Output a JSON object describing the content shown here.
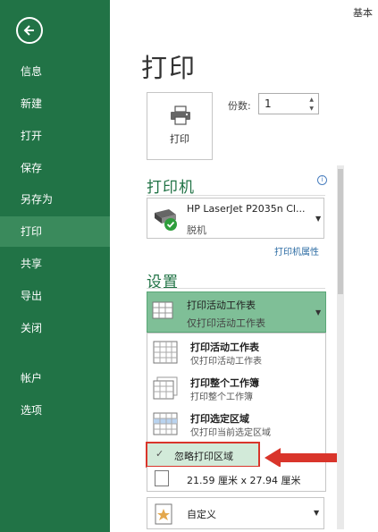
{
  "header": {
    "top_right_text": "基本"
  },
  "sidebar": {
    "items": [
      {
        "label": "信息"
      },
      {
        "label": "新建"
      },
      {
        "label": "打开"
      },
      {
        "label": "保存"
      },
      {
        "label": "另存为"
      },
      {
        "label": "打印"
      },
      {
        "label": "共享"
      },
      {
        "label": "导出"
      },
      {
        "label": "关闭"
      },
      {
        "label": "帐户"
      },
      {
        "label": "选项"
      }
    ],
    "active": "打印"
  },
  "main": {
    "title": "打印",
    "print_button_label": "打印",
    "copies": {
      "label": "份数:",
      "value": "1"
    },
    "printer": {
      "section_title": "打印机",
      "name": "HP LaserJet P2035n Cl...",
      "status": "脱机",
      "properties_link": "打印机属性"
    },
    "settings": {
      "section_title": "设置",
      "selected": {
        "title": "打印活动工作表",
        "subtitle": "仅打印活动工作表"
      },
      "options": [
        {
          "title": "打印活动工作表",
          "subtitle": "仅打印活动工作表"
        },
        {
          "title": "打印整个工作簿",
          "subtitle": "打印整个工作簿"
        },
        {
          "title": "打印选定区域",
          "subtitle": "仅打印当前选定区域"
        }
      ],
      "ignore_print_area": {
        "label": "忽略打印区域",
        "checked": true
      },
      "paper_size": "21.59 厘米 x 27.94 厘米",
      "custom": "自定义"
    }
  },
  "colors": {
    "sidebar": "#217346",
    "accent": "#217346",
    "highlight": "#d9352b",
    "selected": "#7fbf97"
  }
}
